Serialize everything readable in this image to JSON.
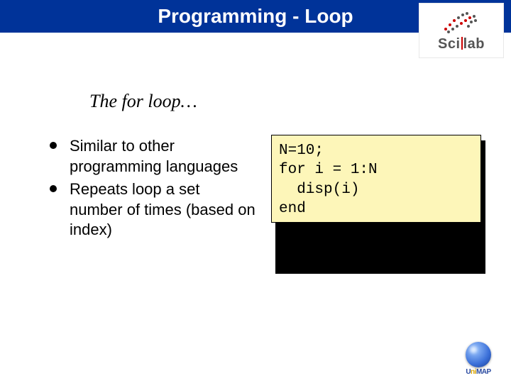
{
  "title": "Programming - Loop",
  "subtitle": "The for loop…",
  "bullets": [
    "Similar to other programming languages",
    "Repeats loop a set number of times (based on index)"
  ],
  "code": "N=10;\nfor i = 1:N\n  disp(i)\nend",
  "logo_scilab": {
    "text_left": "Sci",
    "text_right": "lab"
  },
  "logo_unimap": {
    "text_left": "U",
    "text_mid": "ni",
    "text_right": "MAP"
  }
}
